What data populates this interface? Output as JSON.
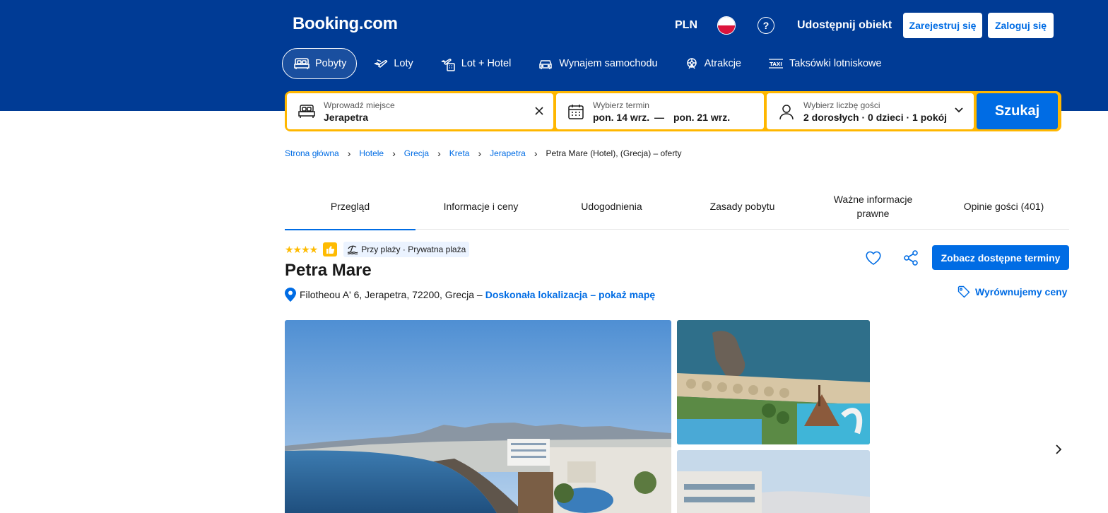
{
  "header": {
    "logo": "Booking.com",
    "currency": "PLN",
    "list_property": "Udostępnij obiekt",
    "register": "Zarejestruj się",
    "login": "Zaloguj się"
  },
  "nav": [
    {
      "label": "Pobyty",
      "icon": "bed-icon",
      "active": true
    },
    {
      "label": "Loty",
      "icon": "plane-icon"
    },
    {
      "label": "Lot + Hotel",
      "icon": "flight-hotel-icon"
    },
    {
      "label": "Wynajem samochodu",
      "icon": "car-icon"
    },
    {
      "label": "Atrakcje",
      "icon": "attractions-icon"
    },
    {
      "label": "Taksówki lotniskowe",
      "icon": "taxi-icon"
    }
  ],
  "search": {
    "destination_label": "Wprowadź miejsce",
    "destination_value": "Jerapetra",
    "date_label": "Wybierz termin",
    "checkin": "pon. 14 wrz.",
    "date_separator": "—",
    "checkout": "pon. 21 wrz.",
    "guests_label": "Wybierz liczbę gości",
    "guests_value": "2 dorosłych · 0 dzieci · 1 pokój",
    "submit": "Szukaj"
  },
  "breadcrumbs": [
    "Strona główna",
    "Hotele",
    "Grecja",
    "Kreta",
    "Jerapetra"
  ],
  "breadcrumb_current": "Petra Mare (Hotel), (Grecja) – oferty",
  "tabs": [
    {
      "label": "Przegląd",
      "active": true
    },
    {
      "label": "Informacje i ceny"
    },
    {
      "label": "Udogodnienia"
    },
    {
      "label": "Zasady pobytu"
    },
    {
      "label": "Ważne informacje prawne"
    },
    {
      "label": "Opinie gości (401)"
    }
  ],
  "hotel": {
    "stars": "★★★★",
    "star_count": 4,
    "beach_badge": "Przy plaży · Prywatna plaża",
    "name": "Petra Mare",
    "address": "Filotheou A' 6, Jerapetra, 72200, Grecja –",
    "map_link": "Doskonała lokalizacja – pokaż mapę",
    "available_button": "Zobacz dostępne terminy",
    "price_match": "Wyrównujemy ceny"
  },
  "colors": {
    "brand_blue": "#003b95",
    "action_blue": "#006ce4",
    "search_border": "#ffb700",
    "star_yellow": "#febb02"
  }
}
